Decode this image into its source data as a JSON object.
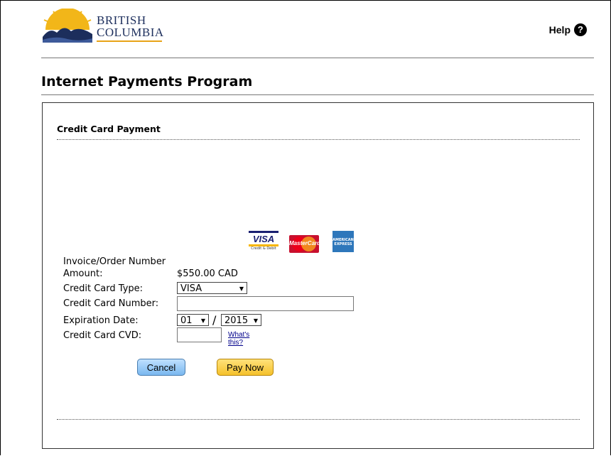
{
  "header": {
    "logo_line1": "BRITISH",
    "logo_line2": "COLUMBIA",
    "help_label": "Help",
    "help_icon": "?"
  },
  "page_title": "Internet Payments Program",
  "panel": {
    "section_title": "Credit Card Payment",
    "card_logos": {
      "visa": "VISA",
      "visa_sub": "Credit & Debit",
      "mastercard": "MasterCard",
      "amex": "AMERICAN EXPRESS"
    }
  },
  "form": {
    "invoice_label": "Invoice/Order Number",
    "amount_label": "Amount:",
    "amount_value": "$550.00 CAD",
    "card_type_label": "Credit Card Type:",
    "card_type_value": "VISA",
    "card_number_label": "Credit Card Number:",
    "card_number_value": "",
    "expiration_label": "Expiration Date:",
    "exp_month": "01",
    "exp_separator": "/",
    "exp_year": "2015",
    "cvd_label": "Credit Card CVD:",
    "cvd_value": "",
    "whats_this": "What's this?"
  },
  "buttons": {
    "cancel": "Cancel",
    "pay_now": "Pay Now"
  },
  "colors": {
    "cancel_bg": "#7ab8ef",
    "pay_bg": "#f5c12b",
    "link": "#00008b"
  }
}
